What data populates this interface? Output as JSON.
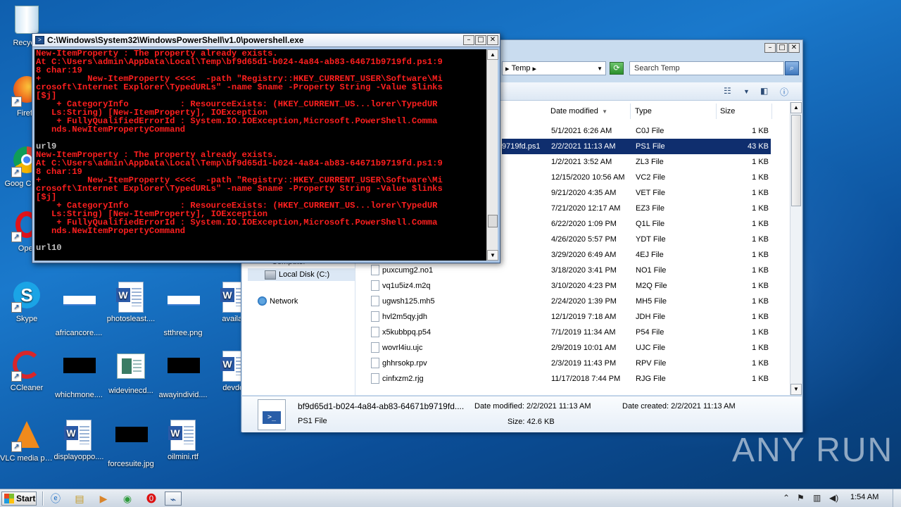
{
  "desktop": {
    "icons": [
      {
        "label": "Recycle",
        "kind": "recycle"
      },
      {
        "label": "Firefo",
        "kind": "firefox"
      },
      {
        "label": "Goog Chrom",
        "kind": "chrome"
      },
      {
        "label": "Oper",
        "kind": "opera"
      },
      {
        "label": "Skype",
        "kind": "skype"
      },
      {
        "label": "africancore....",
        "kind": "image"
      },
      {
        "label": "photosleast....",
        "kind": "word"
      },
      {
        "label": "stthree.png",
        "kind": "image"
      },
      {
        "label": "availabi",
        "kind": "word"
      },
      {
        "label": "CCleaner",
        "kind": "ccleaner"
      },
      {
        "label": "whichmone....",
        "kind": "black"
      },
      {
        "label": "widevinecd...",
        "kind": "widevine"
      },
      {
        "label": "awayindivid....",
        "kind": "black"
      },
      {
        "label": "devdoc",
        "kind": "word"
      },
      {
        "label": "VLC media player",
        "kind": "vlc"
      },
      {
        "label": "displayoppo....",
        "kind": "word"
      },
      {
        "label": "forcesuite.jpg",
        "kind": "black"
      },
      {
        "label": "oilmini.rtf",
        "kind": "word"
      }
    ]
  },
  "powershell": {
    "title": "C:\\Windows\\System32\\WindowsPowerShell\\v1.0\\powershell.exe",
    "lines": [
      {
        "t": "New-ItemProperty : The property already exists.",
        "c": "red"
      },
      {
        "t": "At C:\\Users\\admin\\AppData\\Local\\Temp\\bf9d65d1-b024-4a84-ab83-64671b9719fd.ps1:9",
        "c": "red"
      },
      {
        "t": "8 char:19",
        "c": "red"
      },
      {
        "t": "+         New-ItemProperty <<<<  -path \"Registry::HKEY_CURRENT_USER\\Software\\Mi",
        "c": "red"
      },
      {
        "t": "crosoft\\Internet Explorer\\TypedURLs\" -name $name -Property String -Value $links",
        "c": "red"
      },
      {
        "t": "[$j]",
        "c": "red"
      },
      {
        "t": "    + CategoryInfo          : ResourceExists: (HKEY_CURRENT_US...lorer\\TypedUR",
        "c": "red"
      },
      {
        "t": "   Ls:String) [New-ItemProperty], IOException",
        "c": "red"
      },
      {
        "t": "    + FullyQualifiedErrorId : System.IO.IOException,Microsoft.PowerShell.Comma",
        "c": "red"
      },
      {
        "t": "   nds.NewItemPropertyCommand",
        "c": "red"
      },
      {
        "t": " ",
        "c": "gray"
      },
      {
        "t": "url9",
        "c": "gray"
      },
      {
        "t": "New-ItemProperty : The property already exists.",
        "c": "red"
      },
      {
        "t": "At C:\\Users\\admin\\AppData\\Local\\Temp\\bf9d65d1-b024-4a84-ab83-64671b9719fd.ps1:9",
        "c": "red"
      },
      {
        "t": "8 char:19",
        "c": "red"
      },
      {
        "t": "+         New-ItemProperty <<<<  -path \"Registry::HKEY_CURRENT_USER\\Software\\Mi",
        "c": "red"
      },
      {
        "t": "crosoft\\Internet Explorer\\TypedURLs\" -name $name -Property String -Value $links",
        "c": "red"
      },
      {
        "t": "[$j]",
        "c": "red"
      },
      {
        "t": "    + CategoryInfo          : ResourceExists: (HKEY_CURRENT_US...lorer\\TypedUR",
        "c": "red"
      },
      {
        "t": "   Ls:String) [New-ItemProperty], IOException",
        "c": "red"
      },
      {
        "t": "    + FullyQualifiedErrorId : System.IO.IOException,Microsoft.PowerShell.Comma",
        "c": "red"
      },
      {
        "t": "   nds.NewItemPropertyCommand",
        "c": "red"
      },
      {
        "t": " ",
        "c": "gray"
      },
      {
        "t": "url10",
        "c": "gray"
      }
    ]
  },
  "explorer": {
    "address_segment": "Temp",
    "search_placeholder": "Search Temp",
    "nav": {
      "computer": "Computer",
      "local_disk": "Local Disk (C:)",
      "network": "Network"
    },
    "columns": {
      "date": "Date modified",
      "type": "Type",
      "size": "Size"
    },
    "rows": [
      {
        "name": "",
        "date": "5/1/2021 6:26 AM",
        "type": "C0J File",
        "size": "1 KB",
        "selected": false
      },
      {
        "name": "9719fd.ps1",
        "date": "2/2/2021 11:13 AM",
        "type": "PS1 File",
        "size": "43 KB",
        "selected": true
      },
      {
        "name": "",
        "date": "1/2/2021 3:52 AM",
        "type": "ZL3 File",
        "size": "1 KB",
        "selected": false
      },
      {
        "name": "",
        "date": "12/15/2020 10:56 AM",
        "type": "VC2 File",
        "size": "1 KB",
        "selected": false
      },
      {
        "name": "",
        "date": "9/21/2020 4:35 AM",
        "type": "VET File",
        "size": "1 KB",
        "selected": false
      },
      {
        "name": "",
        "date": "7/21/2020 12:17 AM",
        "type": "EZ3 File",
        "size": "1 KB",
        "selected": false
      },
      {
        "name": "",
        "date": "6/22/2020 1:09 PM",
        "type": "Q1L File",
        "size": "1 KB",
        "selected": false
      },
      {
        "name": "",
        "date": "4/26/2020 5:57 PM",
        "type": "YDT File",
        "size": "1 KB",
        "selected": false
      },
      {
        "name": "",
        "date": "3/29/2020 6:49 AM",
        "type": "4EJ File",
        "size": "1 KB",
        "selected": false
      },
      {
        "name": "puxcumg2.no1",
        "date": "3/18/2020 3:41 PM",
        "type": "NO1 File",
        "size": "1 KB",
        "selected": false
      },
      {
        "name": "vq1u5iz4.m2q",
        "date": "3/10/2020 4:23 PM",
        "type": "M2Q File",
        "size": "1 KB",
        "selected": false
      },
      {
        "name": "ugwsh125.mh5",
        "date": "2/24/2020 1:39 PM",
        "type": "MH5 File",
        "size": "1 KB",
        "selected": false
      },
      {
        "name": "hvl2m5qy.jdh",
        "date": "12/1/2019 7:18 AM",
        "type": "JDH File",
        "size": "1 KB",
        "selected": false
      },
      {
        "name": "x5kubbpq.p54",
        "date": "7/1/2019 11:34 AM",
        "type": "P54 File",
        "size": "1 KB",
        "selected": false
      },
      {
        "name": "wovrl4iu.ujc",
        "date": "2/9/2019 10:01 AM",
        "type": "UJC File",
        "size": "1 KB",
        "selected": false
      },
      {
        "name": "ghhrsokp.rpv",
        "date": "2/3/2019 11:43 PM",
        "type": "RPV File",
        "size": "1 KB",
        "selected": false
      },
      {
        "name": "cinfxzm2.rjg",
        "date": "11/17/2018 7:44 PM",
        "type": "RJG File",
        "size": "1 KB",
        "selected": false
      }
    ],
    "details": {
      "filename": "bf9d65d1-b024-4a84-ab83-64671b9719fd....",
      "filetype": "PS1 File",
      "date_modified": "Date modified:  2/2/2021 11:13 AM",
      "date_created": "Date created:  2/2/2021 11:13 AM",
      "size": "Size:  42.6 KB"
    }
  },
  "watermark": "ANY RUN",
  "taskbar": {
    "start_label": "Start",
    "clock": "1:54 AM"
  }
}
